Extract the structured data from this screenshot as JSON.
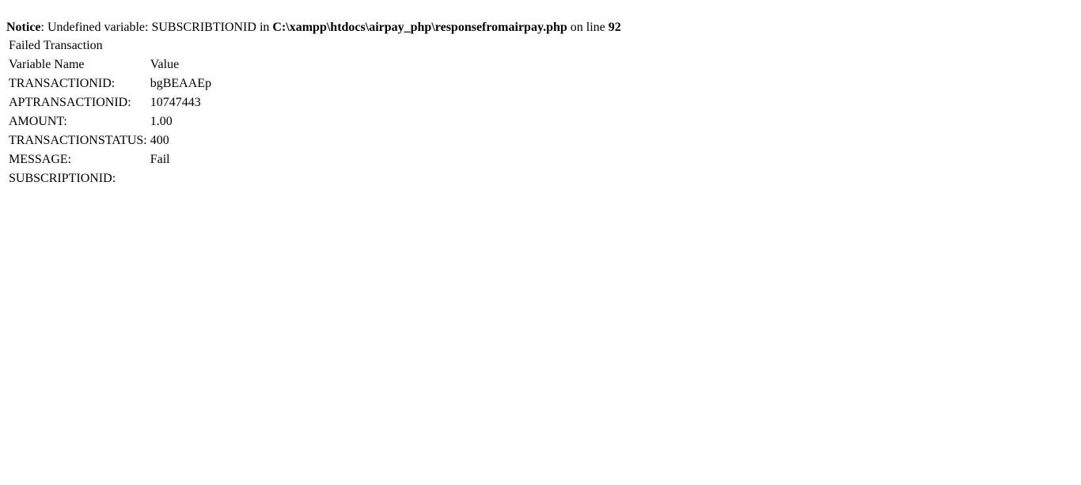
{
  "notice": {
    "label": "Notice",
    "text_1": ": Undefined variable: SUBSCRIBTIONID in ",
    "file_path": "C:\\xampp\\htdocs\\airpay_php\\responsefromairpay.php",
    "text_2": " on line ",
    "line_number": "92"
  },
  "result": {
    "title": "Failed Transaction",
    "headers": {
      "name": "Variable Name",
      "value": "Value"
    },
    "rows": [
      {
        "name": "TRANSACTIONID:",
        "value": "bgBEAAEp"
      },
      {
        "name": "APTRANSACTIONID:",
        "value": "10747443"
      },
      {
        "name": "AMOUNT:",
        "value": "1.00"
      },
      {
        "name": "TRANSACTIONSTATUS:",
        "value": "400"
      },
      {
        "name": "MESSAGE:",
        "value": "Fail"
      },
      {
        "name": "SUBSCRIPTIONID:",
        "value": ""
      }
    ]
  }
}
